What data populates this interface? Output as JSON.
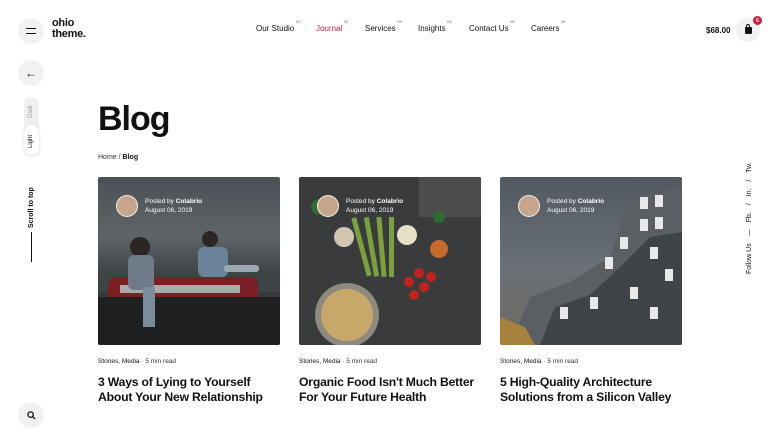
{
  "brand": {
    "line1": "ohio",
    "line2": "theme."
  },
  "nav": [
    {
      "label": "Our Studio",
      "num": "01"
    },
    {
      "label": "Journal",
      "num": "02"
    },
    {
      "label": "Services",
      "num": "03"
    },
    {
      "label": "Insights",
      "num": "04"
    },
    {
      "label": "Contact Us",
      "num": "05"
    },
    {
      "label": "Careers",
      "num": "06"
    }
  ],
  "cart": {
    "price": "$68.00",
    "count": "6"
  },
  "theme": {
    "dark": "Dark",
    "light": "Light"
  },
  "scroll_to_top": "Scroll to top",
  "follow": {
    "label": "Follow Us",
    "dash": "—",
    "links": [
      "Fb.",
      "/",
      "In.",
      "/",
      "Tw."
    ]
  },
  "page": {
    "title": "Blog",
    "breadcrumb_home": "Home",
    "breadcrumb_sep": "/",
    "breadcrumb_current": "Blog"
  },
  "posts": [
    {
      "posted_by_prefix": "Posted by",
      "author": "Colabrio",
      "date": "August 06, 2019",
      "categories": "Stories, Media",
      "read_time": "5 min read",
      "title": "3 Ways of Lying to Yourself About Your New Relationship"
    },
    {
      "posted_by_prefix": "Posted by",
      "author": "Colabrio",
      "date": "August 06, 2019",
      "categories": "Stories, Media",
      "read_time": "5 min read",
      "title": "Organic Food Isn't Much Better For Your Future Health"
    },
    {
      "posted_by_prefix": "Posted by",
      "author": "Colabrio",
      "date": "August 06, 2019",
      "categories": "Stories, Media",
      "read_time": "5 min read",
      "title": "5 High-Quality Architecture Solutions from a Silicon Valley"
    }
  ],
  "colors": {
    "accent": "#d81d3a"
  },
  "icons": {
    "menu": "hamburger-icon",
    "back": "arrow-left-icon",
    "cart": "shopping-bag-icon",
    "search": "search-icon"
  }
}
